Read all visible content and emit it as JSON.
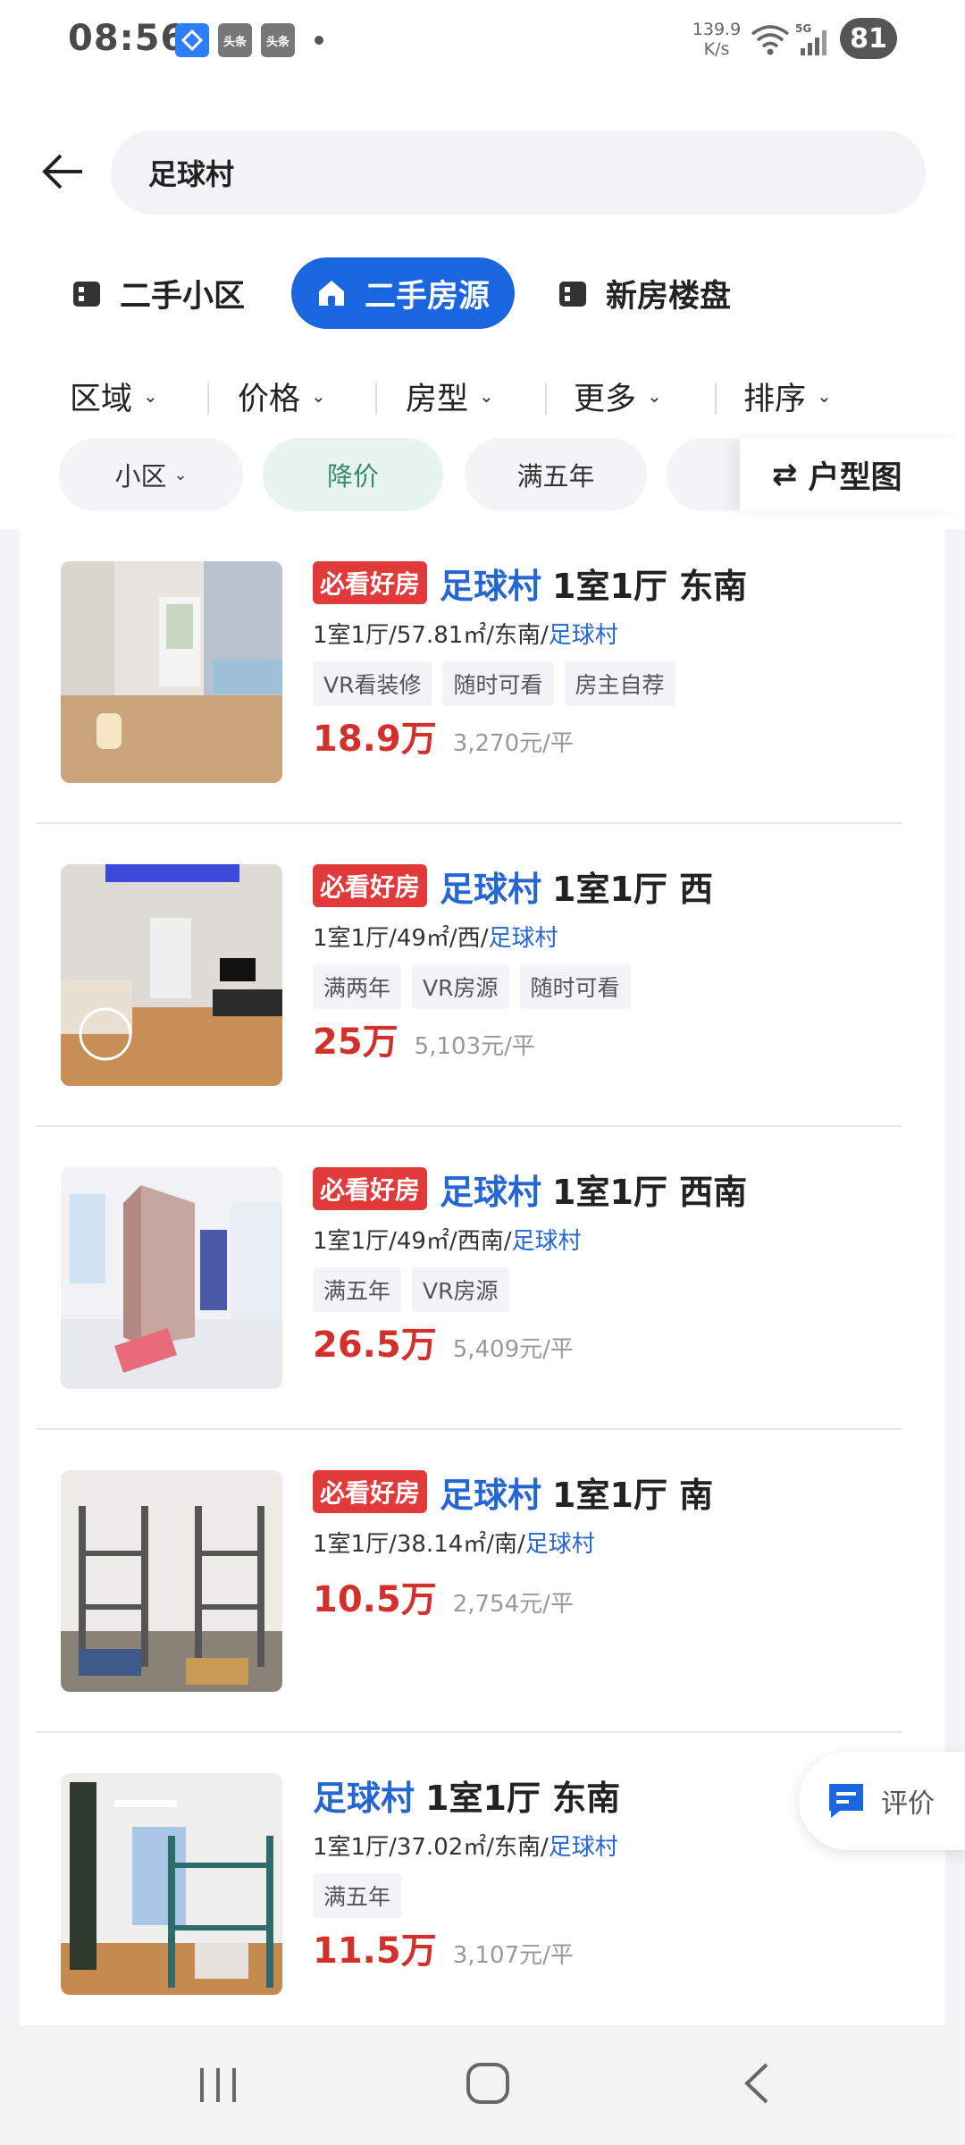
{
  "status_bar": {
    "time": "08:56",
    "app_badges": [
      "头条",
      "头条"
    ],
    "net_speed_value": "139.9",
    "net_speed_unit": "K/s",
    "network": "5G",
    "battery": "81"
  },
  "search": {
    "query": "足球村"
  },
  "category_tabs": [
    {
      "label": "二手小区",
      "active": false
    },
    {
      "label": "二手房源",
      "active": true
    },
    {
      "label": "新房楼盘",
      "active": false
    }
  ],
  "filters": [
    "区域",
    "价格",
    "房型",
    "更多",
    "排序"
  ],
  "chips": [
    {
      "label": "小区",
      "has_dropdown": true,
      "active": false
    },
    {
      "label": "降价",
      "has_dropdown": false,
      "active": true
    },
    {
      "label": "满五年",
      "has_dropdown": false,
      "active": false
    }
  ],
  "floorplan_button": "户型图",
  "listings": [
    {
      "badge": "必看好房",
      "community": "足球村",
      "title_rest": "1室1厅 东南",
      "meta_prefix": "1室1厅/57.81㎡/东南/",
      "meta_link": "足球村",
      "tags": [
        "VR看装修",
        "随时可看",
        "房主自荐"
      ],
      "price": "18.9万",
      "unit_price": "3,270元/平"
    },
    {
      "badge": "必看好房",
      "community": "足球村",
      "title_rest": "1室1厅 西",
      "meta_prefix": "1室1厅/49㎡/西/",
      "meta_link": "足球村",
      "tags": [
        "满两年",
        "VR房源",
        "随时可看"
      ],
      "price": "25万",
      "unit_price": "5,103元/平"
    },
    {
      "badge": "必看好房",
      "community": "足球村",
      "title_rest": "1室1厅 西南",
      "meta_prefix": "1室1厅/49㎡/西南/",
      "meta_link": "足球村",
      "tags": [
        "满五年",
        "VR房源"
      ],
      "price": "26.5万",
      "unit_price": "5,409元/平"
    },
    {
      "badge": "必看好房",
      "community": "足球村",
      "title_rest": "1室1厅 南",
      "meta_prefix": "1室1厅/38.14㎡/南/",
      "meta_link": "足球村",
      "tags": [],
      "price": "10.5万",
      "unit_price": "2,754元/平"
    },
    {
      "badge": "",
      "community": "足球村",
      "title_rest": "1室1厅 东南",
      "meta_prefix": "1室1厅/37.02㎡/东南/",
      "meta_link": "足球村",
      "tags": [
        "满五年"
      ],
      "price": "11.5万",
      "unit_price": "3,107元/平"
    }
  ],
  "review_button": "评价",
  "colors": {
    "accent_blue": "#1a66e0",
    "link_blue": "#2466d4",
    "price_red": "#d3302c",
    "badge_red": "#e23a3a"
  }
}
